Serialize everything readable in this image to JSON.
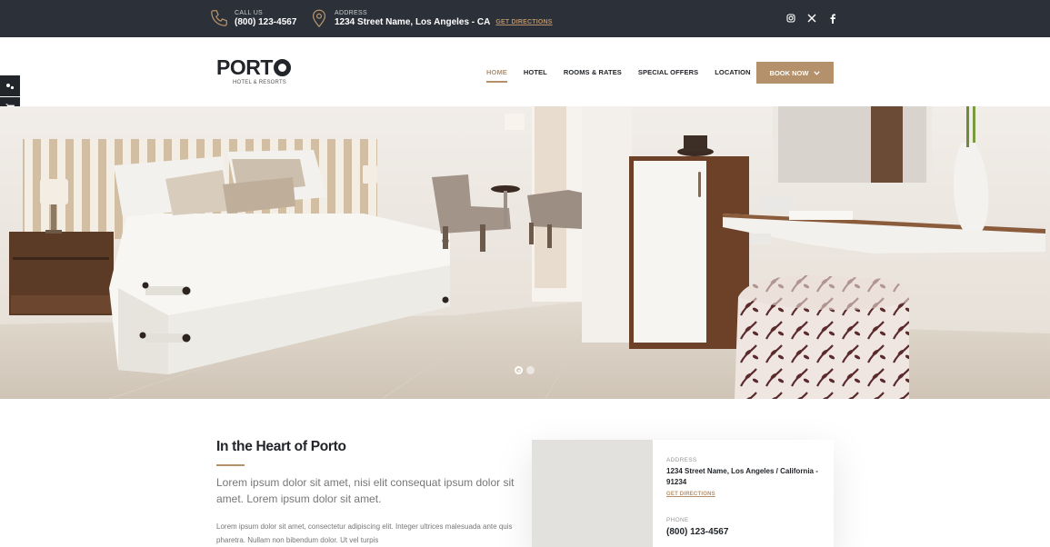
{
  "topbar": {
    "call_label": "CALL US",
    "call_value": "(800) 123-4567",
    "address_label": "ADDRESS",
    "address_value": "1234 Street Name, Los Angeles - CA",
    "directions_link": "GET DIRECTIONS",
    "social_icons": [
      "instagram-icon",
      "x-icon",
      "facebook-icon"
    ]
  },
  "header": {
    "logo_text": "PORT",
    "logo_sub": "HOTEL & RESORTS",
    "nav": [
      {
        "label": "HOME",
        "active": true
      },
      {
        "label": "HOTEL",
        "active": false
      },
      {
        "label": "ROOMS & RATES",
        "active": false
      },
      {
        "label": "SPECIAL OFFERS",
        "active": false
      },
      {
        "label": "LOCATION",
        "active": false
      }
    ],
    "book_button": "BOOK NOW"
  },
  "side_widgets": [
    "settings-icon",
    "cart-icon",
    "target-icon"
  ],
  "hero": {
    "slide_count": 2,
    "active_slide": 1
  },
  "intro": {
    "title": "In the Heart of Porto",
    "lead": "Lorem ipsum dolor sit amet, nisi elit consequat ipsum dolor sit amet. Lorem ipsum dolor sit amet.",
    "body": "Lorem ipsum dolor sit amet, consectetur adipiscing elit. Integer ultrices malesuada ante quis pharetra. Nullam non bibendum dolor. Ut vel turpis"
  },
  "contact_card": {
    "address_label": "ADDRESS",
    "address_value": "1234 Street Name, Los Angeles / California - 91234",
    "directions_link": "GET DIRECTIONS",
    "phone_label": "PHONE",
    "phone_value": "(800) 123-4567"
  },
  "colors": {
    "accent": "#b4916a",
    "topbar_bg": "#2c3038",
    "dark": "#222529"
  }
}
